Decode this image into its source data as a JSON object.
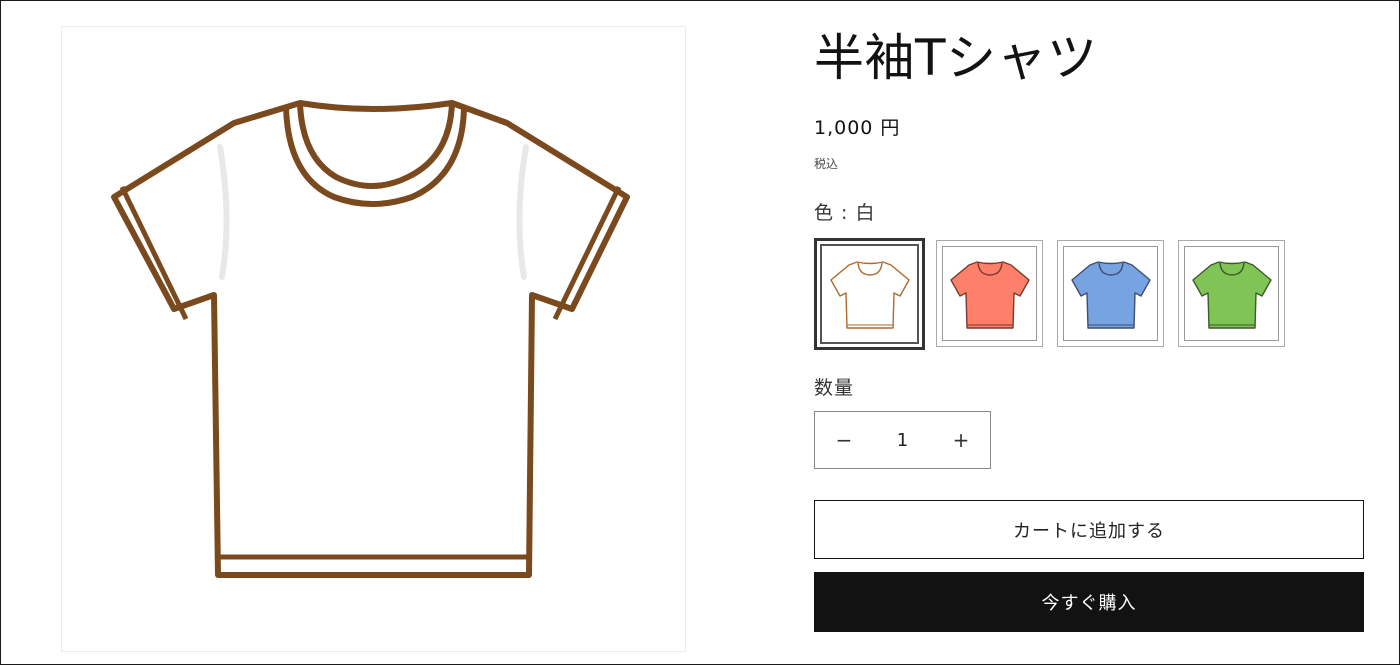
{
  "product": {
    "title": "半袖Tシャツ",
    "price": "1,000 円",
    "tax_note": "税込",
    "main_image_icon": "tshirt-white-icon"
  },
  "options": {
    "color_label": "色 : 白",
    "swatches": [
      {
        "name": "白",
        "color": "#ffffff",
        "outline": "#b06a2a",
        "selected": true
      },
      {
        "name": "赤",
        "color": "#fe7f6a",
        "outline": "#7a3a2a",
        "selected": false
      },
      {
        "name": "青",
        "color": "#77a3e2",
        "outline": "#3f4f6e",
        "selected": false
      },
      {
        "name": "緑",
        "color": "#7fc455",
        "outline": "#3d5a2a",
        "selected": false
      }
    ]
  },
  "quantity": {
    "label": "数量",
    "value": "1",
    "minus": "−",
    "plus": "+"
  },
  "actions": {
    "add_to_cart": "カートに追加する",
    "buy_now": "今すぐ購入"
  }
}
